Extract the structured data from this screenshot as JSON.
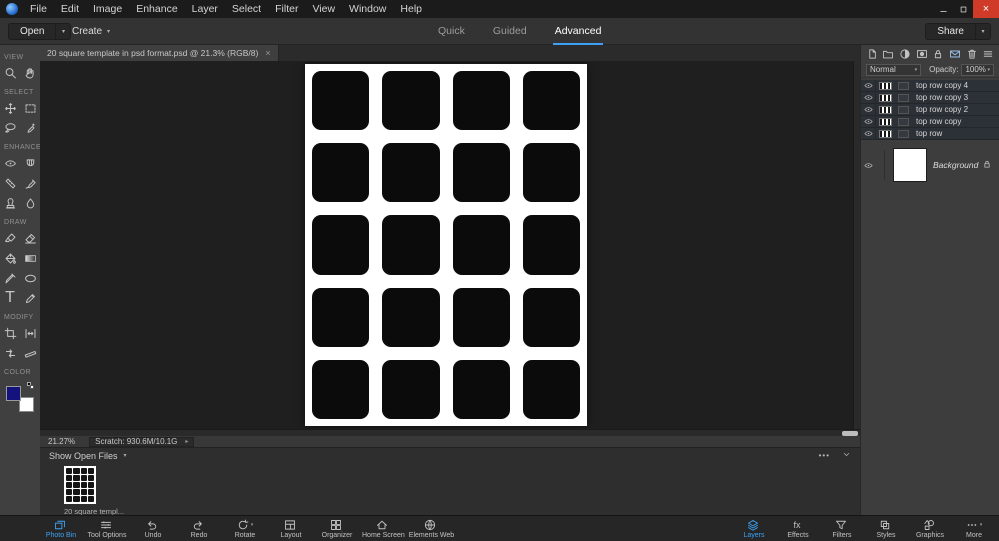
{
  "menubar": {
    "menus": [
      "File",
      "Edit",
      "Image",
      "Enhance",
      "Layer",
      "Select",
      "Filter",
      "View",
      "Window",
      "Help"
    ]
  },
  "toolbar": {
    "open_label": "Open",
    "create_label": "Create",
    "share_label": "Share",
    "modes": [
      {
        "label": "Quick",
        "active": false
      },
      {
        "label": "Guided",
        "active": false
      },
      {
        "label": "Advanced",
        "active": true
      }
    ]
  },
  "document_tab": {
    "title": "20 square template in psd format.psd @ 21.3% (RGB/8)",
    "close_glyph": "×"
  },
  "tool_panel": {
    "sections": [
      {
        "label": "VIEW",
        "tools": [
          "zoom",
          "hand"
        ]
      },
      {
        "label": "SELECT",
        "tools": [
          "move",
          "marquee",
          "lasso",
          "quick-selection"
        ]
      },
      {
        "label": "ENHANCE",
        "tools": [
          "red-eye",
          "whiten-teeth",
          "spot-healing",
          "smart-brush",
          "clone-stamp",
          "blur"
        ]
      },
      {
        "label": "DRAW",
        "tools": [
          "brush",
          "eraser",
          "paint-bucket",
          "gradient",
          "eyedropper",
          "shape",
          "type",
          "pencil"
        ]
      },
      {
        "label": "MODIFY",
        "tools": [
          "crop",
          "recompose",
          "content-aware-move",
          "straighten"
        ]
      },
      {
        "label": "COLOR",
        "tools": []
      }
    ],
    "foreground_color": "#14137e",
    "background_color": "#ffffff"
  },
  "canvas": {
    "grid_rows": 5,
    "grid_cols": 4,
    "square_color": "#0b0b0b",
    "doc_background": "#ffffff"
  },
  "statusbar": {
    "zoom_level": "21.27%",
    "scratch": "Scratch: 930.6M/10.1G"
  },
  "photo_bin": {
    "header": "Show Open Files",
    "thumbnail_caption": "20 square templ..."
  },
  "layers_panel": {
    "blend_mode": "Normal",
    "opacity_label": "Opacity:",
    "opacity_value": "100%",
    "layers": [
      {
        "name": "top row copy 4"
      },
      {
        "name": "top row copy 3"
      },
      {
        "name": "top row copy 2"
      },
      {
        "name": "top row copy"
      },
      {
        "name": "top row"
      }
    ],
    "background_layer": {
      "name": "Background"
    }
  },
  "taskbar": {
    "left_items": [
      {
        "label": "Photo Bin",
        "icon": "photo-bin-icon",
        "active": true
      },
      {
        "label": "Tool Options",
        "icon": "tool-options-icon",
        "active": false
      },
      {
        "label": "Undo",
        "icon": "undo-icon",
        "active": false
      },
      {
        "label": "Redo",
        "icon": "redo-icon",
        "active": false
      },
      {
        "label": "Rotate",
        "icon": "rotate-icon",
        "active": false,
        "arrow": "▾"
      },
      {
        "label": "Layout",
        "icon": "layout-icon",
        "active": false
      },
      {
        "label": "Organizer",
        "icon": "organizer-icon",
        "active": false
      },
      {
        "label": "Home Screen",
        "icon": "home-icon",
        "active": false
      },
      {
        "label": "Elements Web",
        "icon": "web-icon",
        "active": false
      }
    ],
    "right_items": [
      {
        "label": "Layers",
        "icon": "layers-icon",
        "active": true
      },
      {
        "label": "Effects",
        "icon": "effects-icon",
        "active": false
      },
      {
        "label": "Filters",
        "icon": "filters-icon",
        "active": false
      },
      {
        "label": "Styles",
        "icon": "styles-icon",
        "active": false
      },
      {
        "label": "Graphics",
        "icon": "graphics-icon",
        "active": false
      },
      {
        "label": "More",
        "icon": "more-icon",
        "active": false,
        "arrow": "▾"
      }
    ]
  },
  "colors": {
    "accent": "#3da2f5",
    "canvas_background": "#1f1f1f"
  }
}
